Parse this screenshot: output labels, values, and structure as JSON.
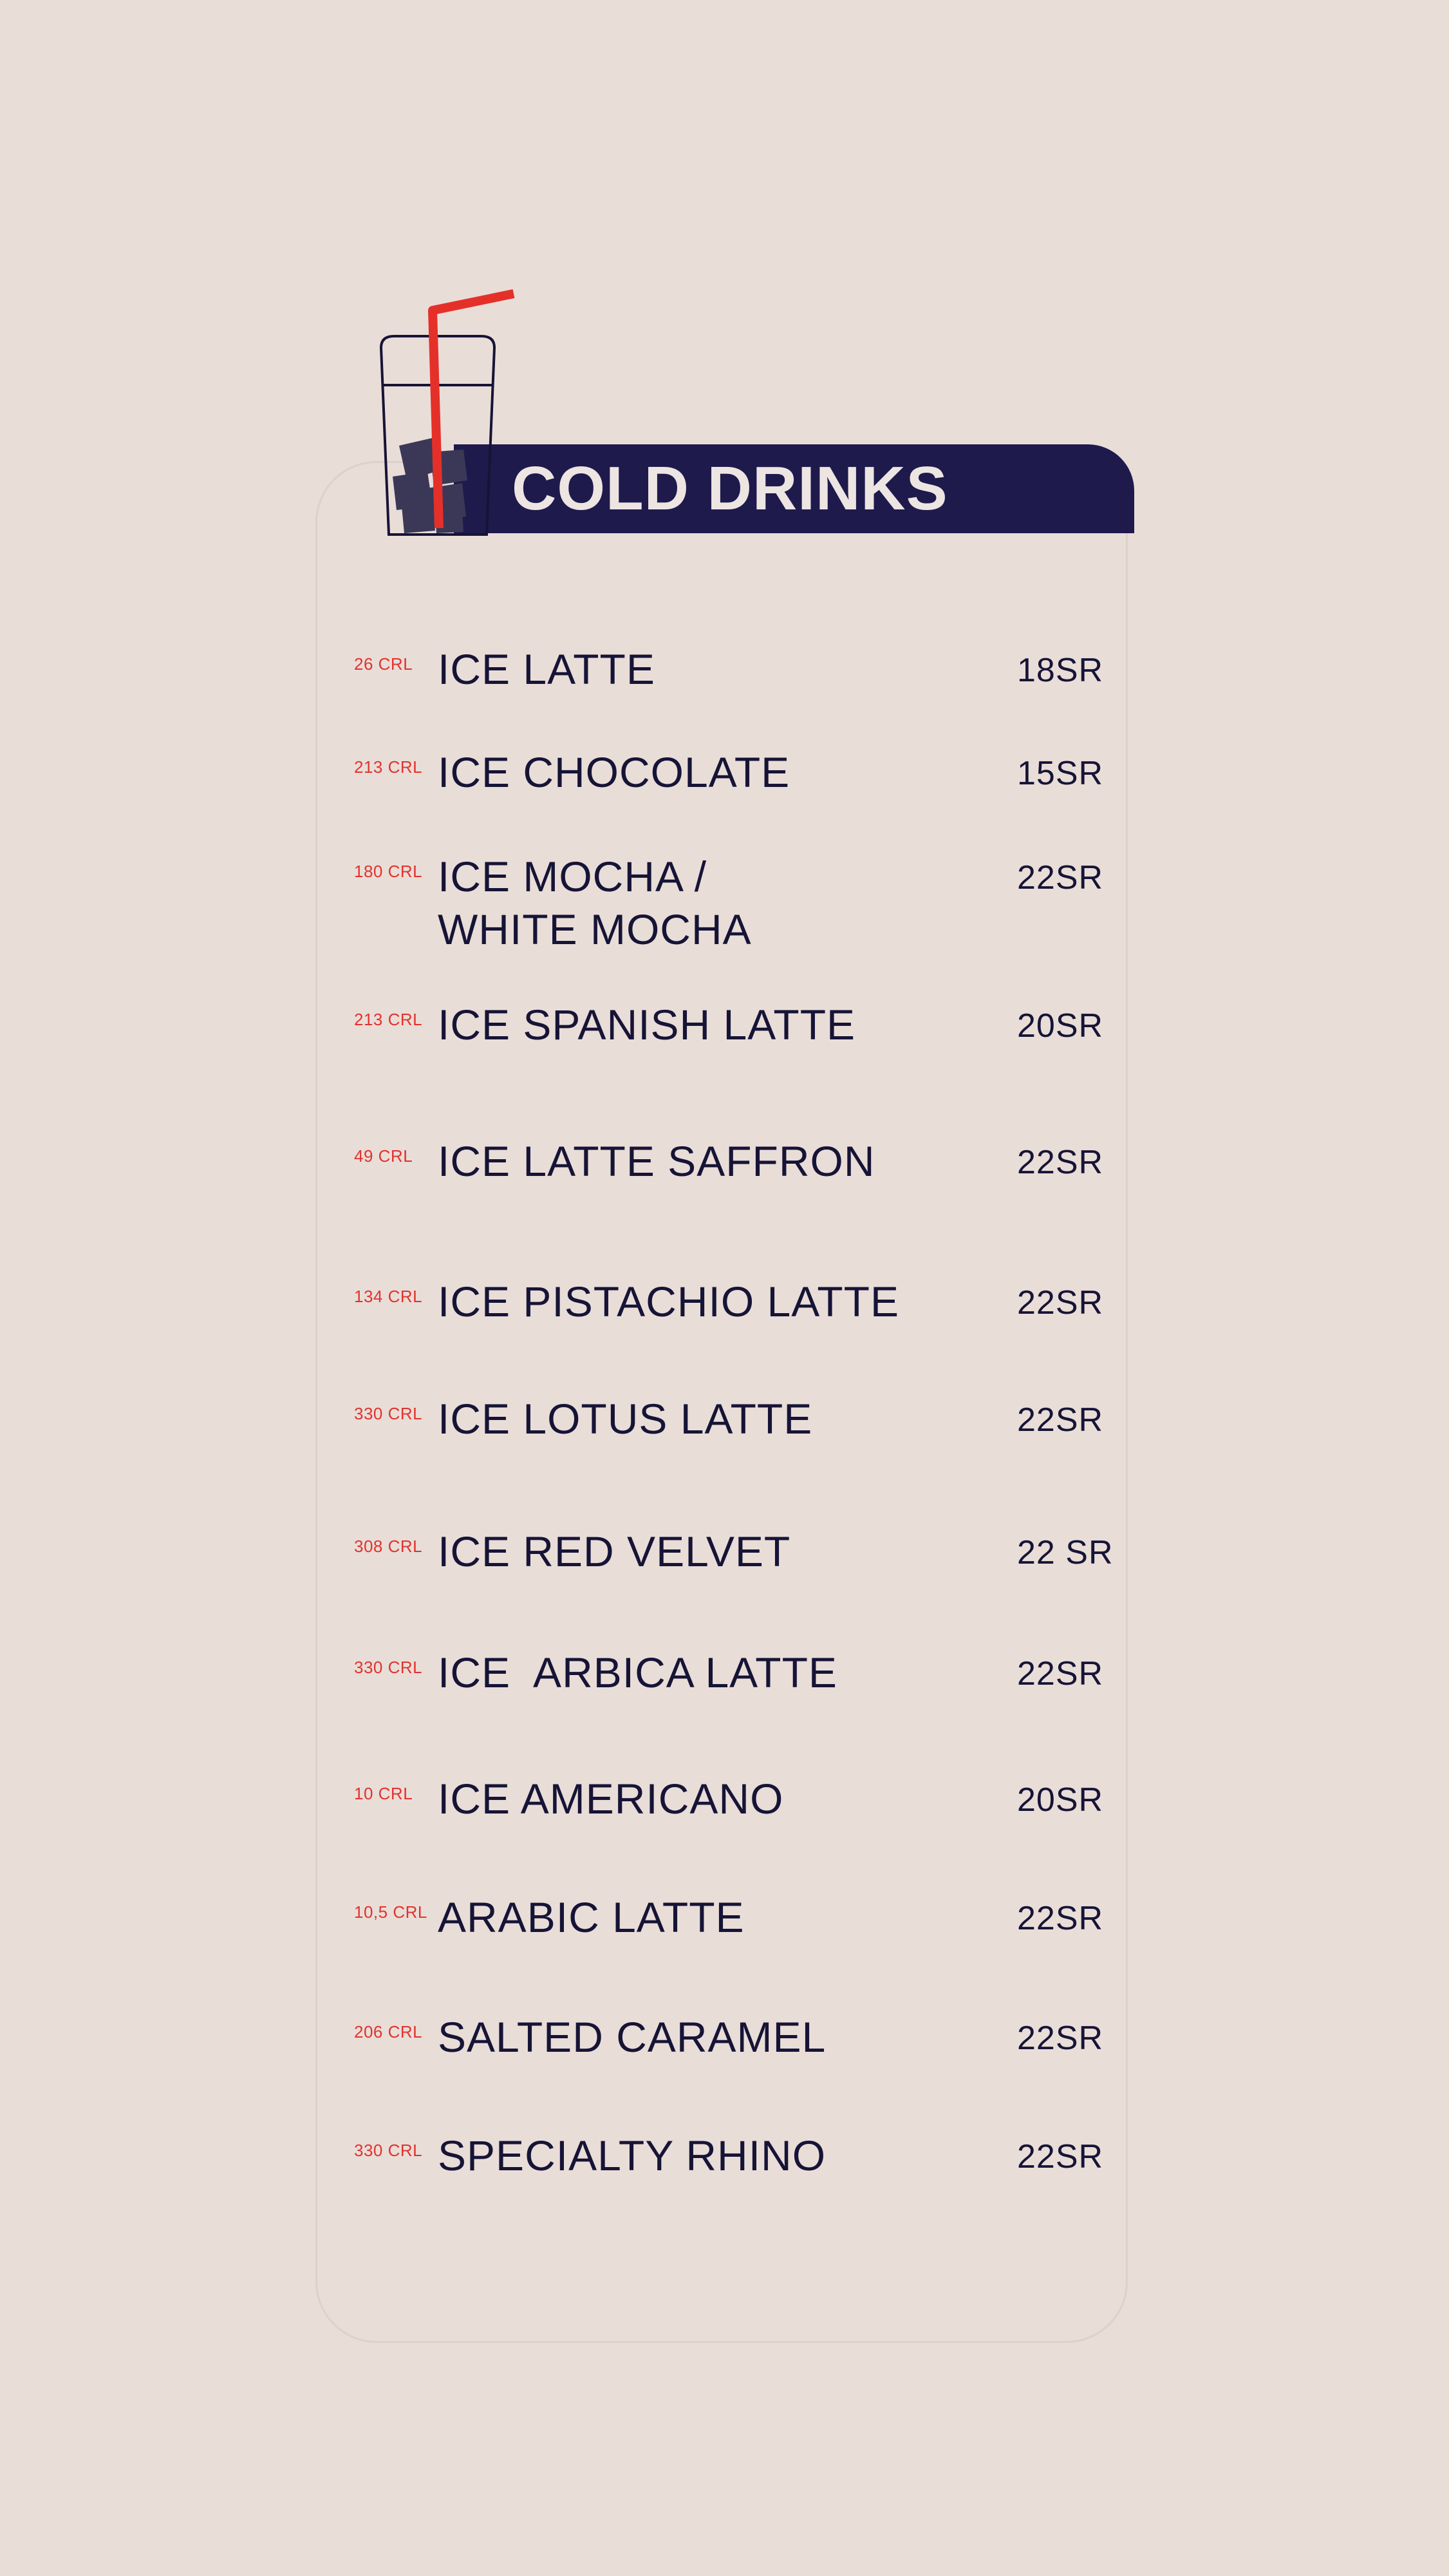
{
  "header": {
    "title": "COLD DRINKS"
  },
  "colors": {
    "background": "#e9ddd8",
    "header_band": "#1e1a4c",
    "header_text": "#ece5e2",
    "calorie_text": "#e1332d",
    "item_text": "#161436",
    "straw": "#e5302a"
  },
  "icon": {
    "name": "iced-drink-cup-icon"
  },
  "items": [
    {
      "calories": "26 CRL",
      "name": "ICE LATTE",
      "price": "18SR"
    },
    {
      "calories": "213 CRL",
      "name": "ICE CHOCOLATE",
      "price": "15SR"
    },
    {
      "calories": "180 CRL",
      "name": "ICE MOCHA /\nWHITE MOCHA",
      "price": "22SR"
    },
    {
      "calories": "213 CRL",
      "name": "ICE SPANISH LATTE",
      "price": "20SR"
    },
    {
      "calories": "49 CRL",
      "name": "ICE LATTE SAFFRON",
      "price": "22SR"
    },
    {
      "calories": "134 CRL",
      "name": "ICE PISTACHIO LATTE",
      "price": "22SR"
    },
    {
      "calories": "330 CRL",
      "name": "ICE LOTUS LATTE",
      "price": "22SR"
    },
    {
      "calories": "308 CRL",
      "name": "ICE RED VELVET",
      "price": "22 SR"
    },
    {
      "calories": "330 CRL",
      "name": "ICE  ARBICA LATTE",
      "price": "22SR"
    },
    {
      "calories": "10 CRL",
      "name": "ICE AMERICANO",
      "price": "20SR"
    },
    {
      "calories": "10,5 CRL",
      "name": "ARABIC LATTE",
      "price": "22SR"
    },
    {
      "calories": "206 CRL",
      "name": "SALTED CARAMEL",
      "price": "22SR"
    },
    {
      "calories": "330 CRL",
      "name": "SPECIALTY RHINO",
      "price": "22SR"
    }
  ]
}
